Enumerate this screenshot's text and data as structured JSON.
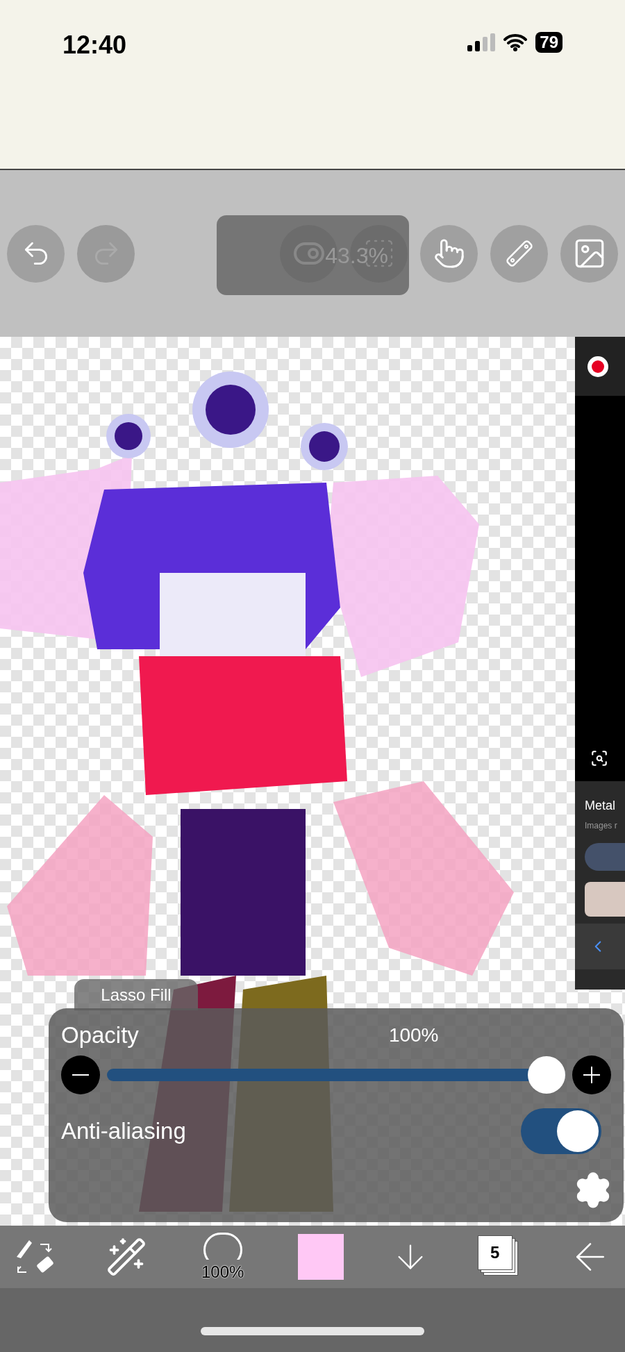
{
  "status_bar": {
    "time": "12:40",
    "battery": "79"
  },
  "toolbar": {
    "zoom_readout": "43.3%"
  },
  "side_panel": {
    "title": "Metal",
    "subtitle": "Images r"
  },
  "brush_panel": {
    "tab": "Lasso Fill",
    "opacity": {
      "label": "Opacity",
      "reading": "100%",
      "level": 1.0
    },
    "anti_aliasing": {
      "label": "Anti-aliasing",
      "on": true
    }
  },
  "bottom_bar": {
    "brush_size": "100%",
    "layer_count": "5"
  }
}
